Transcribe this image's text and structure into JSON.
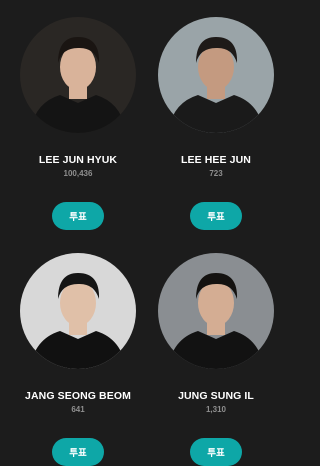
{
  "candidates": [
    {
      "name": "LEE JUN HYUK",
      "votes": "100,436",
      "vote_label": "투표",
      "bg": "#2a2724",
      "skin": "#d9b39a",
      "hair": "#1a1512",
      "jacket": "#141414"
    },
    {
      "name": "LEE HEE JUN",
      "votes": "723",
      "vote_label": "투표",
      "bg": "#9aa4a8",
      "skin": "#c49a80",
      "hair": "#1e1a18",
      "jacket": "#1a1a1a"
    },
    {
      "name": "JANG SEONG BEOM",
      "votes": "641",
      "vote_label": "투표",
      "bg": "#d8d8d8",
      "skin": "#e0c0a8",
      "hair": "#151515",
      "jacket": "#111111"
    },
    {
      "name": "JUNG SUNG IL",
      "votes": "1,310",
      "vote_label": "투표",
      "bg": "#8a8e92",
      "skin": "#d4ad93",
      "hair": "#141210",
      "jacket": "#121212"
    }
  ],
  "colors": {
    "background": "#1c1c1c",
    "accent": "#0ea7a7",
    "votes_text": "#8f8f8f"
  }
}
